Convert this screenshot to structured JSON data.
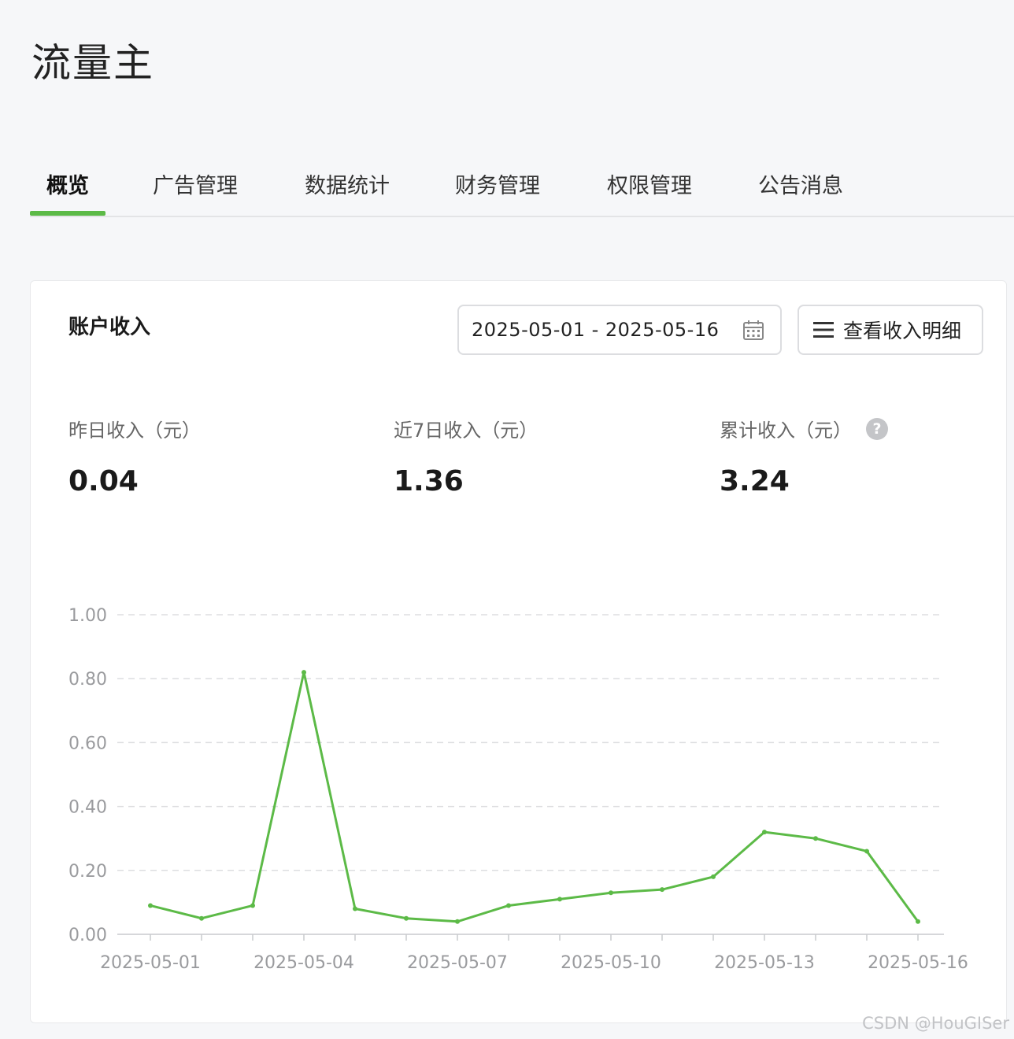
{
  "page": {
    "title": "流量主"
  },
  "tabs": [
    {
      "label": "概览",
      "active": true
    },
    {
      "label": "广告管理"
    },
    {
      "label": "数据统计"
    },
    {
      "label": "财务管理"
    },
    {
      "label": "权限管理"
    },
    {
      "label": "公告消息"
    }
  ],
  "card": {
    "title": "账户收入",
    "date_range": "2025-05-01 - 2025-05-16",
    "detail_button": "查看收入明细",
    "stats": [
      {
        "label": "昨日收入（元）",
        "value": "0.04"
      },
      {
        "label": "近7日收入（元）",
        "value": "1.36"
      },
      {
        "label": "累计收入（元）",
        "value": "3.24"
      }
    ]
  },
  "chart_data": {
    "type": "line",
    "x": [
      "2025-05-01",
      "2025-05-02",
      "2025-05-03",
      "2025-05-04",
      "2025-05-05",
      "2025-05-06",
      "2025-05-07",
      "2025-05-08",
      "2025-05-09",
      "2025-05-10",
      "2025-05-11",
      "2025-05-12",
      "2025-05-13",
      "2025-05-14",
      "2025-05-15",
      "2025-05-16"
    ],
    "x_tick_labels": [
      "2025-05-01",
      "2025-05-04",
      "2025-05-07",
      "2025-05-10",
      "2025-05-13",
      "2025-05-16"
    ],
    "series": [
      {
        "values": [
          0.09,
          0.05,
          0.09,
          0.82,
          0.08,
          0.05,
          0.04,
          0.09,
          0.11,
          0.13,
          0.14,
          0.18,
          0.32,
          0.3,
          0.26,
          0.04
        ],
        "color": "#5cba47"
      }
    ],
    "y_ticks": [
      "0.00",
      "0.20",
      "0.40",
      "0.60",
      "0.80",
      "1.00"
    ],
    "ylim": [
      0,
      1
    ],
    "grid": true
  },
  "watermark": "CSDN @HouGISer",
  "colors": {
    "accent": "#5cba47",
    "help_icon": "#c4c5c8"
  },
  "icons": {
    "date": "calendar-icon",
    "menu": "menu-icon",
    "help": "help-icon"
  }
}
